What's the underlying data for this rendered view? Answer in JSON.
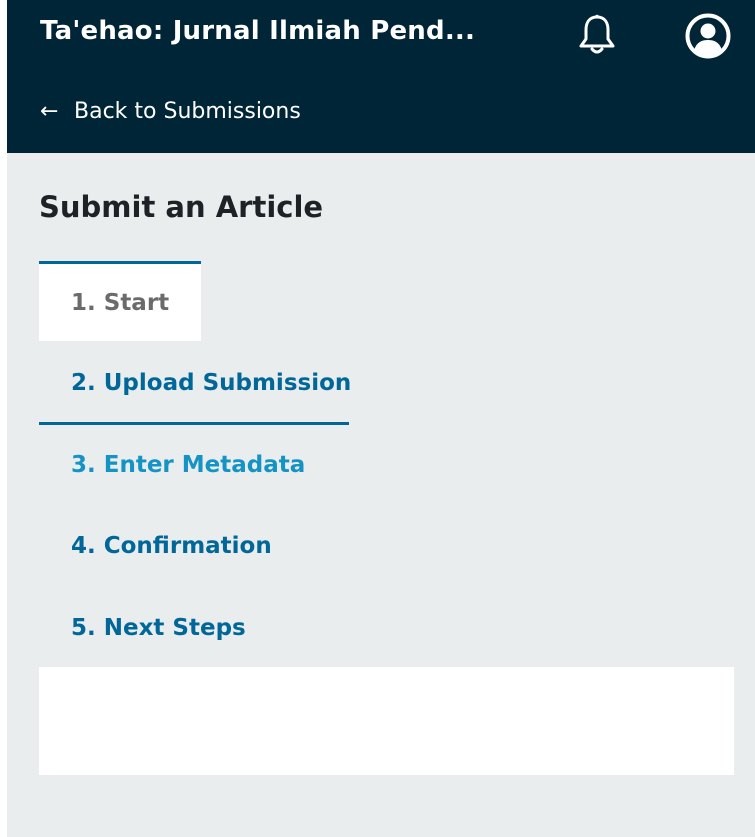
{
  "header": {
    "app_title": "Ta'ehao: Jurnal Ilmiah Pend...",
    "notification_icon": "bell-icon",
    "user_icon": "user-profile-icon",
    "back_arrow": "←",
    "back_label": "Back to Submissions"
  },
  "page": {
    "title": "Submit an Article"
  },
  "steps": [
    {
      "label": "1. Start",
      "state": "active"
    },
    {
      "label": "2. Upload Submission",
      "state": "focused"
    },
    {
      "label": "3. Enter Metadata",
      "state": "default"
    },
    {
      "label": "4. Confirmation",
      "state": "default"
    },
    {
      "label": "5. Next Steps",
      "state": "default"
    }
  ],
  "colors": {
    "header_bg": "#002537",
    "page_bg": "#e9edee",
    "accent": "#006798",
    "accent_light": "#1593c4",
    "active_text": "#6b6b6b"
  }
}
